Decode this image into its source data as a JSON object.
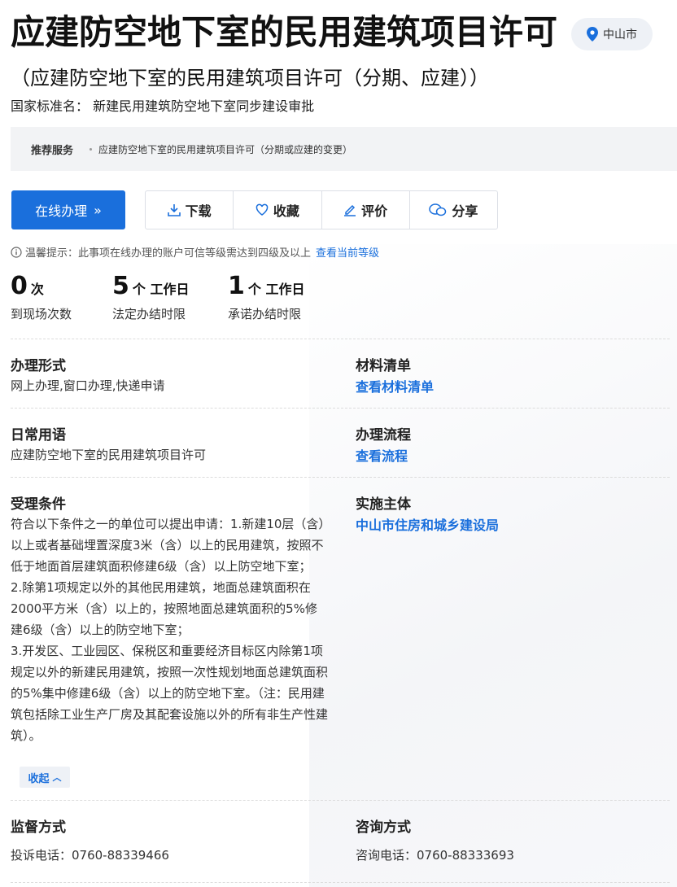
{
  "header": {
    "title": "应建防空地下室的民用建筑项目许可",
    "city": "中山市",
    "subtitle": "（应建防空地下室的民用建筑项目许可（分期、应建））",
    "standard_name": "国家标准名：  新建民用建筑防空地下室同步建设审批"
  },
  "recommend": {
    "label": "推荐服务",
    "items": [
      "应建防空地下室的民用建筑项目许可（分期或应建的变更）"
    ]
  },
  "actions": {
    "online": "在线办理",
    "online_icon": "double-chevron-right-icon",
    "download": "下载",
    "favorite": "收藏",
    "review": "评价",
    "share": "分享"
  },
  "tip": {
    "text": "温馨提示：此事项在线办理的账户可信等级需达到四级及以上",
    "link": "查看当前等级"
  },
  "stats": [
    {
      "value": "0",
      "unit": "次",
      "label": "到现场次数"
    },
    {
      "value": "5",
      "unit": "个 工作日",
      "label": "法定办结时限"
    },
    {
      "value": "1",
      "unit": "个 工作日",
      "label": "承诺办结时限"
    }
  ],
  "fields": {
    "form_label": "办理形式",
    "form_value": "网上办理,窗口办理,快递申请",
    "materials_label": "材料清单",
    "materials_link": "查看材料清单",
    "common_label": "日常用语",
    "common_value": "应建防空地下室的民用建筑项目许可",
    "process_label": "办理流程",
    "process_link": "查看流程",
    "conditions_label": "受理条件",
    "conditions_lines": [
      "符合以下条件之一的单位可以提出申请：1.新建10层（含）以上或者基础埋置深度3米（含）以上的民用建筑，按照不低于地面首层建筑面积修建6级（含）以上防空地下室；",
      "2.除第1项规定以外的其他民用建筑，地面总建筑面积在2000平方米（含）以上的，按照地面总建筑面积的5%修建6级（含）以上的防空地下室；",
      "3.开发区、工业园区、保税区和重要经济目标区内除第1项规定以外的新建民用建筑，按照一次性规划地面总建筑面积的5%集中修建6级（含）以上的防空地下室。（注：民用建筑包括除工业生产厂房及其配套设施以外的所有非生产性建筑）。"
    ],
    "collapse": "收起",
    "entity_label": "实施主体",
    "entity_link": "中山市住房和城乡建设局",
    "supervision_label": "监督方式",
    "supervision_value": "投诉电话：0760-88339466",
    "consult_label": "咨询方式",
    "consult_value": "咨询电话：0760-88333693"
  },
  "colors": {
    "accent": "#1a6fdc",
    "recommend_bg": "#f2f3f5"
  }
}
